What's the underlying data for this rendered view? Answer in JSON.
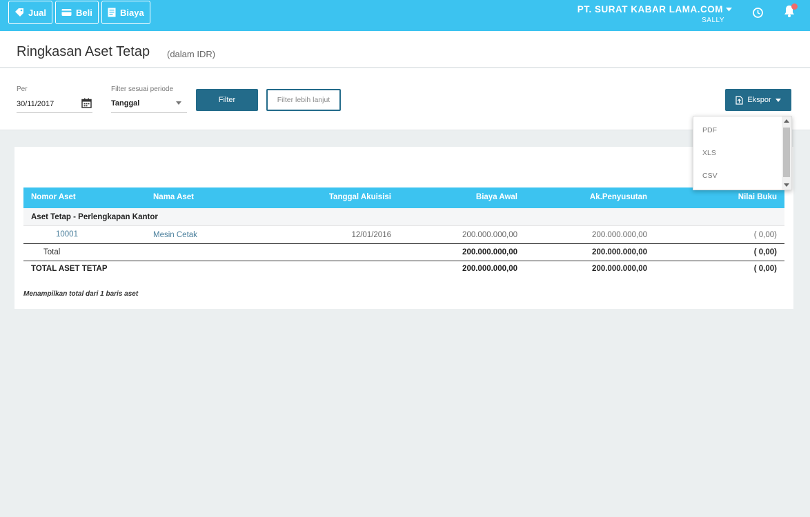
{
  "topbar": {
    "buttons": [
      {
        "label": "Jual",
        "icon": "tag-icon"
      },
      {
        "label": "Beli",
        "icon": "card-icon"
      },
      {
        "label": "Biaya",
        "icon": "receipt-icon"
      }
    ],
    "company": "PT. SURAT KABAR LAMA.COM",
    "user": "SALLY",
    "accent": "#3cc3f0"
  },
  "header": {
    "title": "Ringkasan Aset Tetap",
    "subtitle": "(dalam IDR)"
  },
  "filters": {
    "per_label": "Per",
    "per_value": "30/11/2017",
    "period_label": "Filter sesuai periode",
    "period_value": "Tanggal",
    "filter_button": "Filter",
    "filter_more_button": "Filter lebih lanjut",
    "export_button": "Ekspor",
    "export_options": [
      "PDF",
      "XLS",
      "CSV"
    ]
  },
  "table": {
    "columns": [
      "Nomor Aset",
      "Nama Aset",
      "Tanggal Akuisisi",
      "Biaya Awal",
      "Ak.Penyusutan",
      "Nilai Buku"
    ],
    "group": "Aset Tetap - Perlengkapan Kantor",
    "rows": [
      {
        "nomor": "10001",
        "nama": "Mesin Cetak",
        "tanggal": "12/01/2016",
        "biaya_awal": "200.000.000,00",
        "penyusutan": "200.000.000,00",
        "nilai_buku": "( 0,00)"
      }
    ],
    "total": {
      "label": "Total",
      "biaya_awal": "200.000.000,00",
      "penyusutan": "200.000.000,00",
      "nilai_buku": "( 0,00)"
    },
    "grand_total": {
      "label": "TOTAL ASET TETAP",
      "biaya_awal": "200.000.000,00",
      "penyusutan": "200.000.000,00",
      "nilai_buku": "( 0,00)"
    },
    "footnote": "Menampilkan total dari 1 baris aset"
  }
}
